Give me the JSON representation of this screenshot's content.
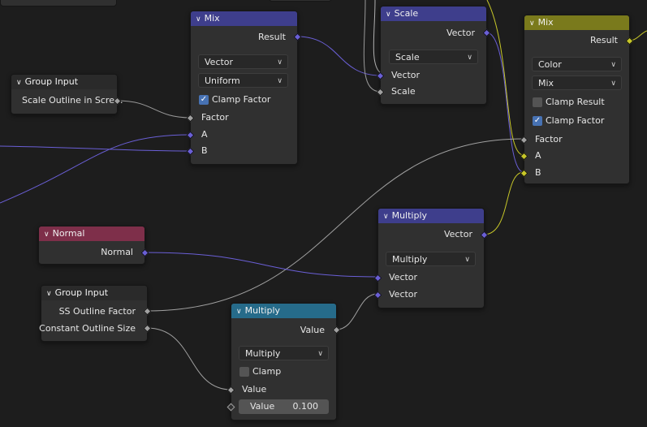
{
  "colors": {
    "vector_header": "#3e3e8c",
    "color_header": "#7a7a1c",
    "input_header": "#2a2a2a",
    "normal_header": "#7e2f4a",
    "converter_header": "#266b8a",
    "vector_socket": "#6a5fd6",
    "float_socket": "#a0a0a0",
    "color_socket": "#c7c729"
  },
  "nodes": {
    "mix_vector": {
      "title": "Mix",
      "output": "Result",
      "data_type": "Vector",
      "mode": "Uniform",
      "clamp_factor": "Clamp Factor",
      "clamp_checked": true,
      "inputs": [
        "Factor",
        "A",
        "B"
      ]
    },
    "scale": {
      "title": "Scale",
      "output": "Vector",
      "operation": "Scale",
      "inputs": [
        "Vector",
        "Scale"
      ]
    },
    "mix_color": {
      "title": "Mix",
      "output": "Result",
      "data_type": "Color",
      "blend": "Mix",
      "clamp_result": "Clamp Result",
      "clamp_result_checked": false,
      "clamp_factor": "Clamp Factor",
      "clamp_factor_checked": true,
      "inputs": [
        "Factor",
        "A",
        "B"
      ]
    },
    "group_input_top": {
      "title": "Group Input",
      "output": "Scale Outline in Scre..."
    },
    "normal": {
      "title": "Normal",
      "output": "Normal"
    },
    "vector_multiply": {
      "title": "Multiply",
      "output": "Vector",
      "operation": "Multiply",
      "inputs": [
        "Vector",
        "Vector"
      ]
    },
    "group_input_bottom": {
      "title": "Group Input",
      "outputs": [
        "SS Outline Factor",
        "Constant Outline Size"
      ]
    },
    "math_multiply": {
      "title": "Multiply",
      "output": "Value",
      "operation": "Multiply",
      "clamp": "Clamp",
      "clamp_checked": false,
      "input": "Value",
      "value_label": "Value",
      "value": "0.100"
    }
  }
}
